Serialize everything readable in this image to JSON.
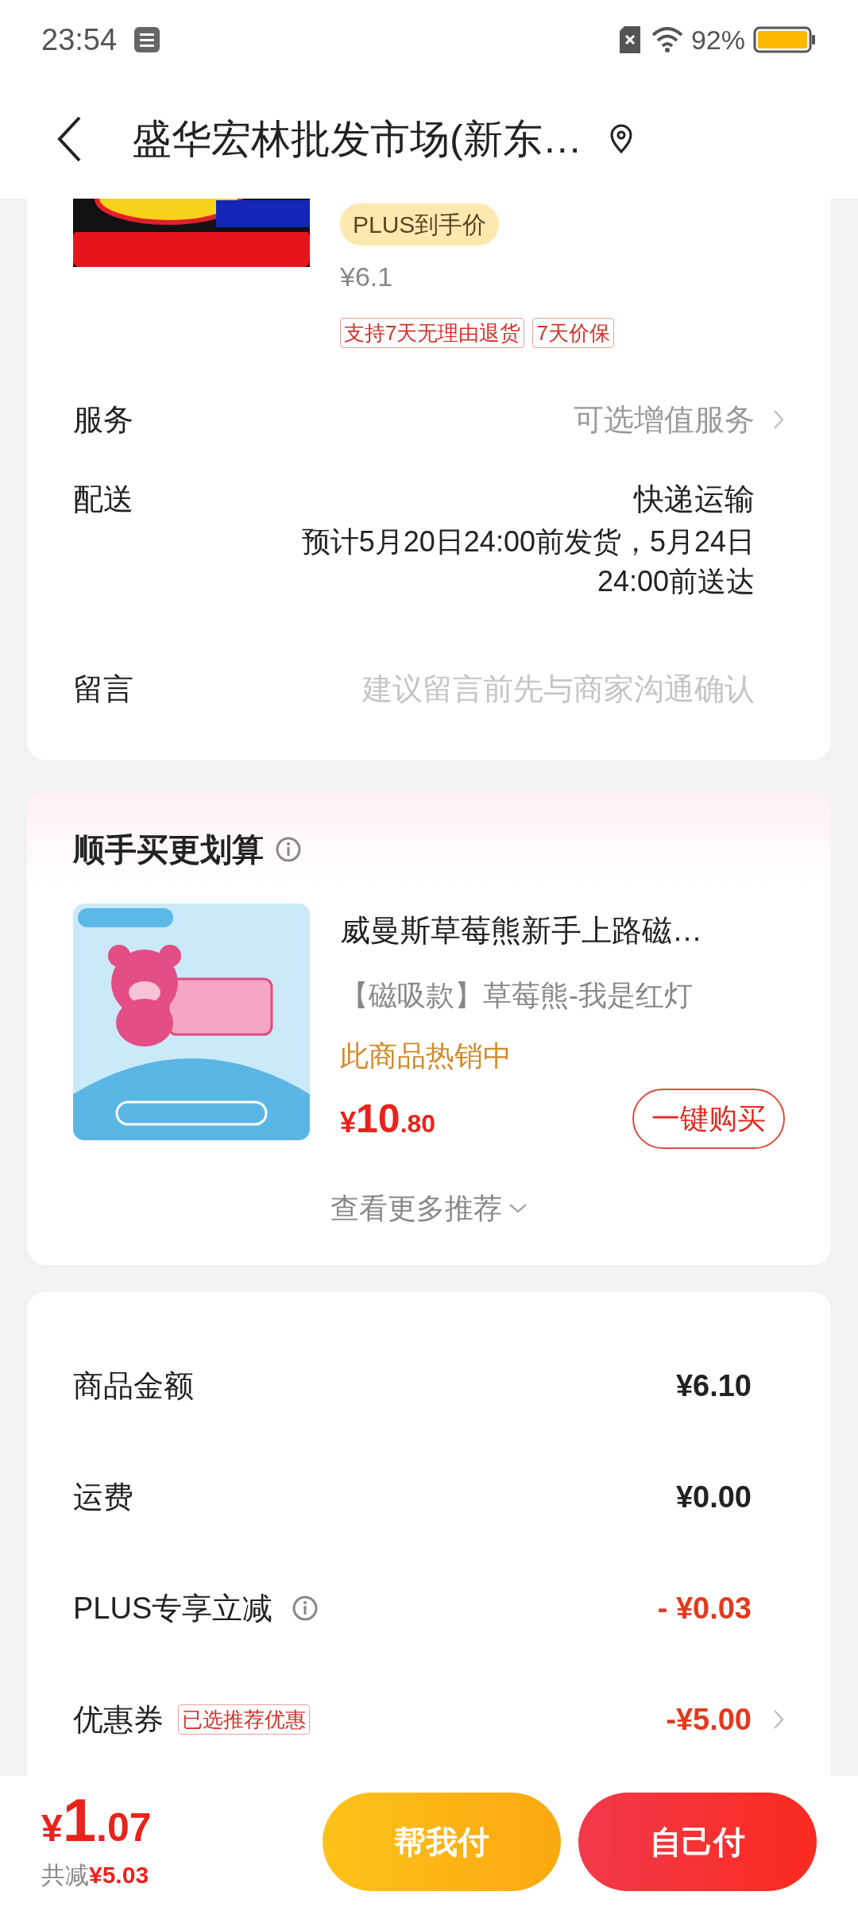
{
  "status_bar": {
    "time": "23:54",
    "battery": "92%"
  },
  "header": {
    "title": "盛华宏林批发市场(新东…"
  },
  "order_item": {
    "image": {
      "kind": "picture"
    },
    "badge": "PLUS到手价",
    "price": "¥6.1",
    "tags": [
      "支持7天无理由退货",
      "7天价保"
    ]
  },
  "details": [
    {
      "label": "服务",
      "kind": "link",
      "value": "可选增值服务"
    },
    {
      "label": "配送",
      "kind": "delivery",
      "value": "快递运输",
      "lines": [
        "预计5月20日24:00前发货，5月24日",
        "24:00前送达"
      ]
    },
    {
      "label": "留言",
      "kind": "input",
      "placeholder": "建议留言前先与商家沟通确认"
    }
  ],
  "recommend": {
    "title": "顺手买更划算",
    "product": {
      "image": {
        "kind": "picture"
      },
      "name": "威曼斯草莓熊新手上路磁…",
      "variant": "【磁吸款】草莓熊-我是红灯",
      "note": "此商品热销中",
      "currency": "¥",
      "price_int": "10",
      "price_dec": ".80",
      "button": "一键购买"
    },
    "more": "查看更多推荐"
  },
  "summary": [
    {
      "label": "商品金额",
      "value": "¥6.10",
      "kind": "plain"
    },
    {
      "label": "运费",
      "value": "¥0.00",
      "kind": "plain"
    },
    {
      "label": "PLUS专享立减",
      "value": "- ¥0.03",
      "kind": "info"
    },
    {
      "label": "优惠券",
      "value": "-¥5.00",
      "kind": "coupon",
      "tag": "已选推荐优惠"
    }
  ],
  "footer": {
    "currency": "¥",
    "total_int": "1",
    "total_dec": ".07",
    "saved_label": "共减",
    "saved": "¥5.03",
    "buttons": [
      {
        "label": "帮我付",
        "kind": "secondary"
      },
      {
        "label": "自己付",
        "kind": "primary"
      }
    ]
  }
}
